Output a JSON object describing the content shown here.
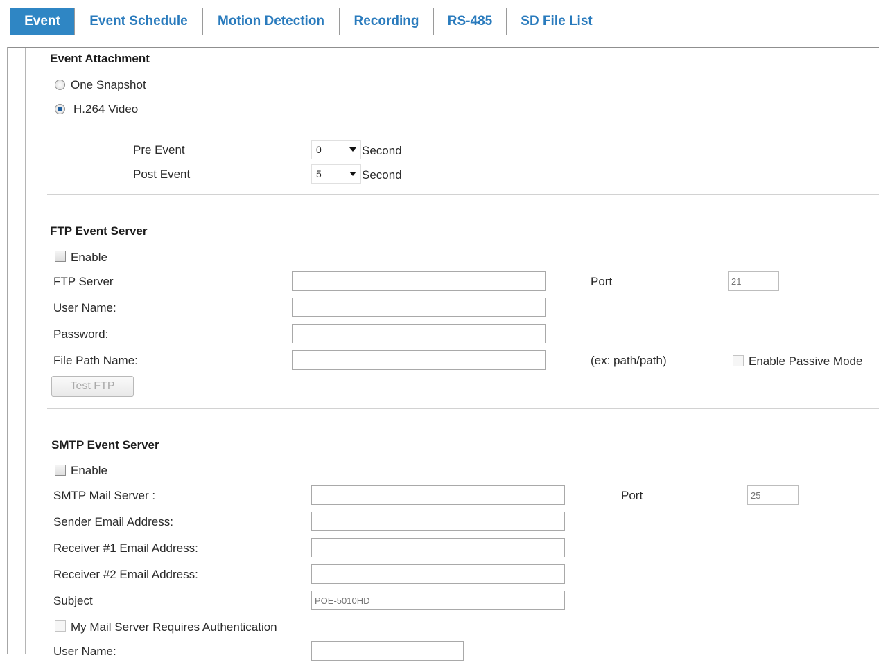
{
  "tabs": [
    "Event",
    "Event Schedule",
    "Motion Detection",
    "Recording",
    "RS-485",
    "SD File List"
  ],
  "attachment": {
    "heading": "Event Attachment",
    "option_snapshot": "One Snapshot",
    "option_video": "H.264 Video",
    "selected": "H.264 Video",
    "pre_event_label": "Pre Event",
    "pre_event_value": "0",
    "post_event_label": "Post Event",
    "post_event_value": "5",
    "unit": "Second"
  },
  "ftp": {
    "heading": "FTP Event Server",
    "enable_label": "Enable",
    "server_label": "FTP Server",
    "server_value": "",
    "port_label": "Port",
    "port_placeholder": "21",
    "user_label": "User Name:",
    "user_value": "",
    "password_label": "Password:",
    "password_value": "",
    "path_label": "File Path Name:",
    "path_value": "",
    "path_hint": "(ex: path/path)",
    "passive_label": "Enable Passive Mode",
    "test_button": "Test FTP"
  },
  "smtp": {
    "heading": "SMTP Event Server",
    "enable_label": "Enable",
    "server_label": "SMTP Mail Server :",
    "server_value": "",
    "port_label": "Port",
    "port_placeholder": "25",
    "sender_label": "Sender Email Address:",
    "sender_value": "",
    "receiver1_label": "Receiver #1 Email Address:",
    "receiver1_value": "",
    "receiver2_label": "Receiver #2 Email Address:",
    "receiver2_value": "",
    "subject_label": "Subject",
    "subject_placeholder": "POE-5010HD",
    "auth_label": "My Mail Server Requires Authentication",
    "user_label": "User Name:"
  },
  "colors": {
    "accent": "#2f86c4",
    "tab_text": "#2a7bbd"
  }
}
